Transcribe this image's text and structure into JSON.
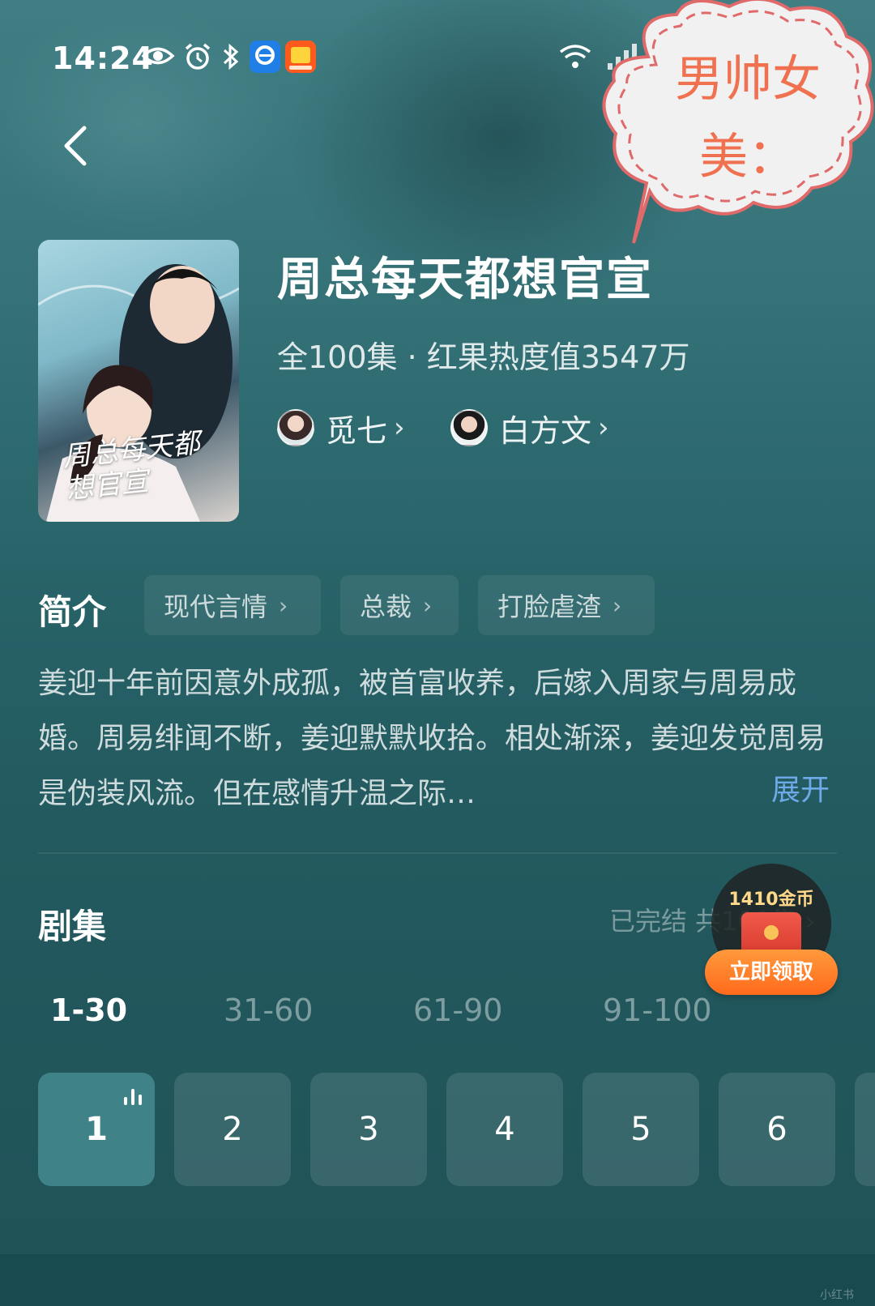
{
  "status_bar": {
    "time": "14:24",
    "icons": [
      "eye-icon",
      "alarm-icon",
      "bluetooth-icon",
      "browser-app-icon",
      "taobao-app-icon",
      "wifi-icon",
      "signal-icon",
      "signal-5g-icon",
      "battery-icon"
    ]
  },
  "sticker": {
    "text": "男帅女美："
  },
  "drama": {
    "title": "周总每天都想官宣",
    "meta": "全100集 · 红果热度值3547万",
    "poster_title": "周总每天都想官宣",
    "actors": [
      {
        "name": "觅七"
      },
      {
        "name": "白方文"
      }
    ]
  },
  "intro": {
    "heading": "简介",
    "tags": [
      "现代言情",
      "总裁",
      "打脸虐渣"
    ],
    "synopsis": "姜迎十年前因意外成孤，被首富收养，后嫁入周家与周易成婚。周易绯闻不断，姜迎默默收拾。相处渐深，姜迎发觉周易是伪装风流。但在感情升温之际…",
    "expand_label": "展开"
  },
  "episodes": {
    "heading": "剧集",
    "status": "已完结 共100集",
    "ranges": [
      "1-30",
      "31-60",
      "61-90",
      "91-100"
    ],
    "active_range": "1-30",
    "items": [
      "1",
      "2",
      "3",
      "4",
      "5",
      "6"
    ],
    "active_episode": "1"
  },
  "coin_reward": {
    "amount": "1410金币",
    "button_label": "立即领取"
  },
  "watermark": "小红书",
  "colors": {
    "accent_blue": "#6ea9e8",
    "sticker_text": "#f07150",
    "reward_orange": "#ff7a28"
  }
}
